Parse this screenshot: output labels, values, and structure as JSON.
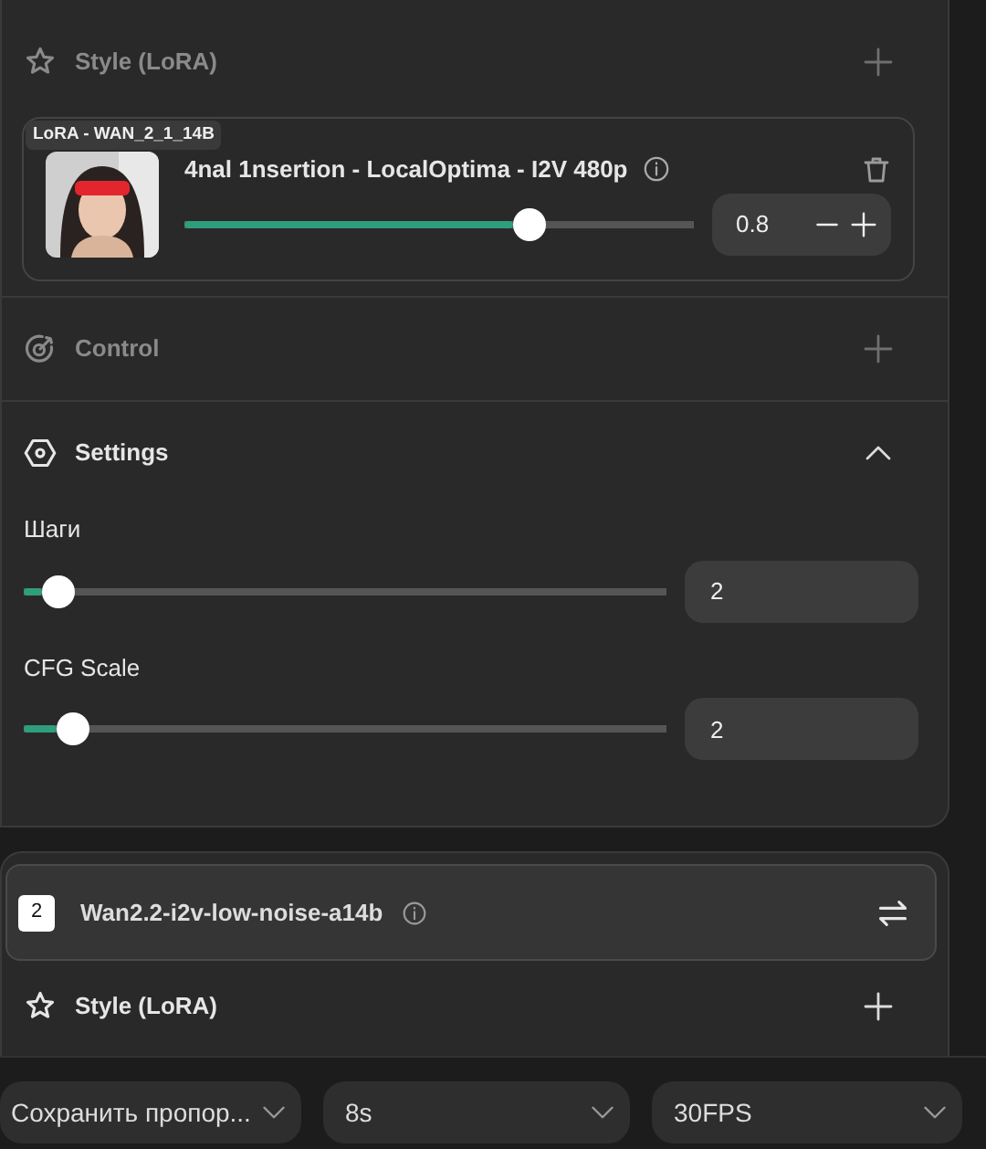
{
  "panel_1": {
    "style_section": {
      "title": "Style (LoRA)",
      "dimmed": true
    },
    "lora": {
      "tag": "LoRA - WAN_2_1_14B",
      "name": "4nal 1nsertion - LocalOptima - I2V 480p",
      "level": 0.69,
      "value": "0.8"
    },
    "control_section": {
      "title": "Control",
      "dimmed": true
    },
    "settings_section": {
      "title": "Settings",
      "dimmed": false,
      "expanded": true,
      "params": [
        {
          "label": "Шаги",
          "level": 0.03,
          "value": "2"
        },
        {
          "label": "CFG Scale",
          "level": 0.055,
          "value": "2"
        }
      ]
    }
  },
  "panel_2": {
    "model": {
      "index": "2",
      "name": "Wan2.2-i2v-low-noise-a14b"
    },
    "style_section": {
      "title": "Style (LoRA)",
      "dimmed": false
    }
  },
  "bottom_bar": {
    "selects": [
      {
        "value": "Сохранить пропор..."
      },
      {
        "value": "8s"
      },
      {
        "value": "30FPS"
      }
    ]
  }
}
